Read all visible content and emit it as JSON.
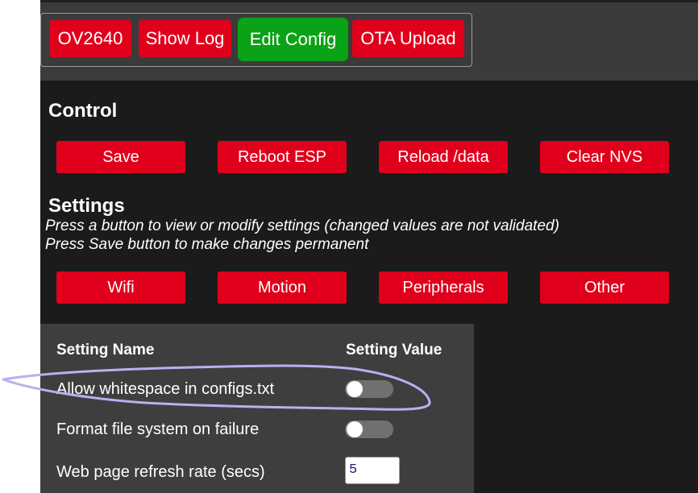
{
  "nav": {
    "buttons": [
      {
        "label": "OV2640"
      },
      {
        "label": "Show Log"
      },
      {
        "label": "Edit Config"
      },
      {
        "label": "OTA Upload"
      }
    ]
  },
  "control": {
    "title": "Control",
    "buttons": [
      "Save",
      "Reboot ESP",
      "Reload /data",
      "Clear NVS"
    ]
  },
  "settings": {
    "title": "Settings",
    "notes": [
      "Press a button to view or modify settings (changed values are not validated)",
      "Press Save button to make changes permanent"
    ],
    "buttons": [
      "Wifi",
      "Motion",
      "Peripherals",
      "Other"
    ]
  },
  "table": {
    "headers": {
      "name": "Setting Name",
      "value": "Setting Value"
    },
    "rows": [
      {
        "label": "Allow whitespace in configs.txt",
        "type": "toggle",
        "on": false
      },
      {
        "label": "Format file system on failure",
        "type": "toggle",
        "on": false
      },
      {
        "label": "Web page refresh rate (secs)",
        "type": "number",
        "value": "5"
      }
    ]
  },
  "colors": {
    "button_red": "#e0001b",
    "active_green": "#0aa216",
    "background": "#1b1b1b",
    "topbar": "#3b3b3b",
    "table_bg": "#3e3e3e",
    "annotation": "#b8b0f0"
  }
}
